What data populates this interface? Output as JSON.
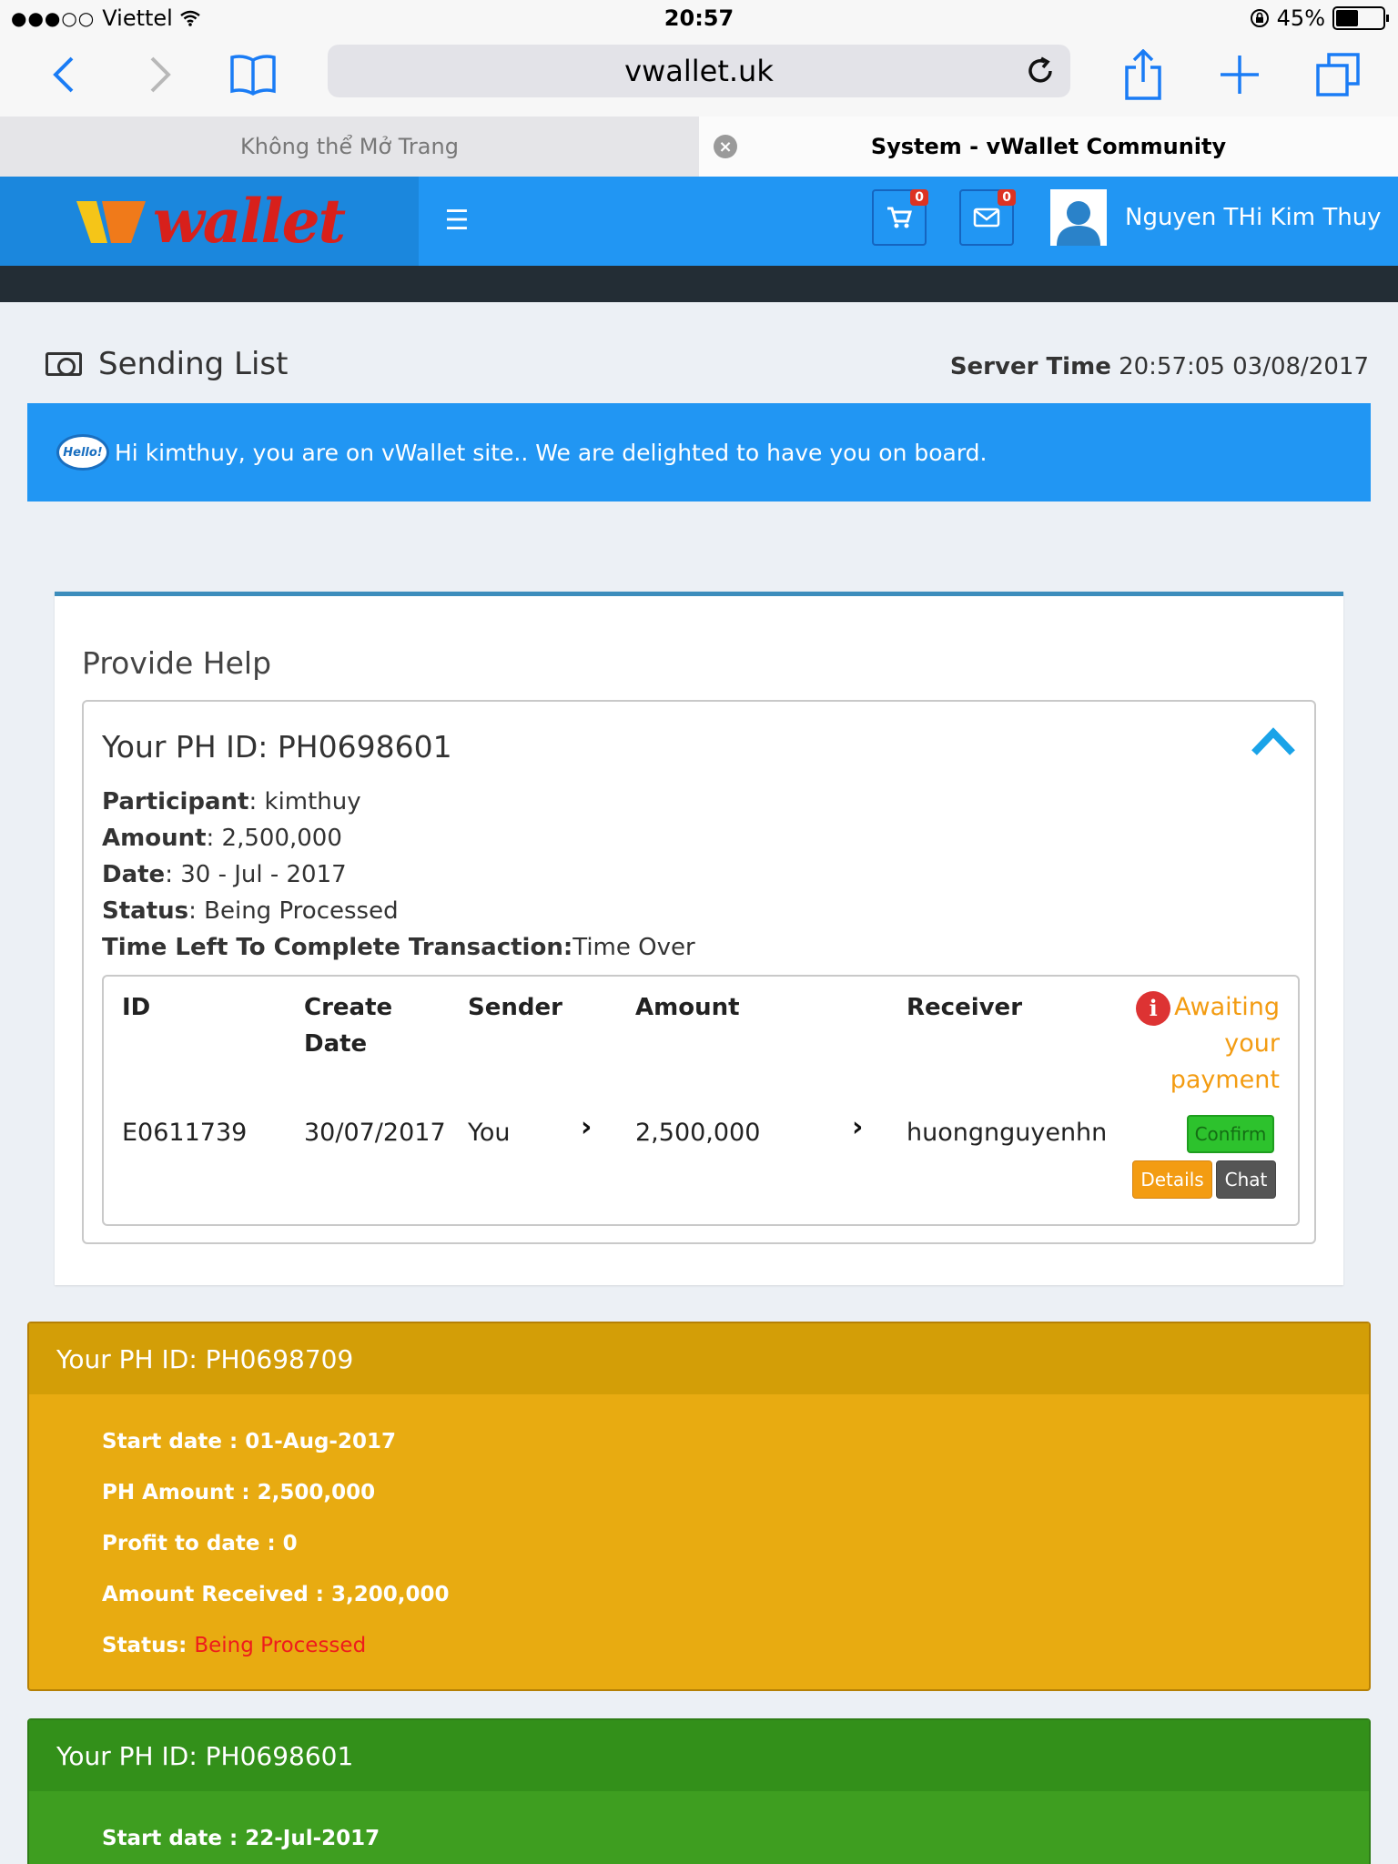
{
  "status_bar": {
    "carrier": "Viettel",
    "time": "20:57",
    "battery": "45%"
  },
  "browser": {
    "url": "vwallet.uk",
    "tabs": [
      {
        "label": "Không thể Mở Trang"
      },
      {
        "label": "System - vWallet Community"
      }
    ]
  },
  "site_header": {
    "logo_text": "wallet",
    "cart_count": "0",
    "mail_count": "0",
    "user_name": "Nguyen THi Kim Thuy"
  },
  "page": {
    "title": "Sending List",
    "server_time_label": "Server Time",
    "server_time_value": "20:57:05 03/08/2017"
  },
  "alert": {
    "bubble": "Hello!",
    "message": "Hi kimthuy, you are on vWallet site.. We are delighted to have you on board."
  },
  "provide_help": {
    "title": "Provide Help",
    "ph_id": "Your PH ID: PH0698601",
    "participant_label": "Participant",
    "participant": ": kimthuy",
    "amount_label": "Amount",
    "amount": ": 2,500,000",
    "date_label": "Date",
    "date": ": 30 - Jul - 2017",
    "status_label": "Status",
    "status": ": Being Processed",
    "time_left_label": "Time Left To Complete Transaction:",
    "time_left": "Time Over",
    "table": {
      "headers": {
        "id": "ID",
        "create": "Create",
        "date": "Date",
        "sender": "Sender",
        "amount": "Amount",
        "receiver": "Receiver"
      },
      "awaiting_1": "Awaiting",
      "awaiting_2": "your",
      "awaiting_3": "payment",
      "row": {
        "id": "E0611739",
        "create_date": "30/07/2017",
        "sender": "You",
        "amount": "2,500,000",
        "receiver": "huongnguyenhn"
      },
      "confirm_label": "Confirm",
      "details_label": "Details",
      "chat_label": "Chat"
    }
  },
  "panel_yellow": {
    "title": "Your PH ID: PH0698709",
    "start_date": "Start date : 01-Aug-2017",
    "ph_amount": "PH Amount : 2,500,000",
    "profit": "Profit to date : 0",
    "amount_received": "Amount Received : 3,200,000",
    "status_label": "Status:",
    "status_value": "Being Processed",
    "color": "#e8ab11"
  },
  "panel_green": {
    "title": "Your PH ID: PH0698601",
    "start_date": "Start date : 22-Jul-2017",
    "color": "#3e9e20"
  }
}
